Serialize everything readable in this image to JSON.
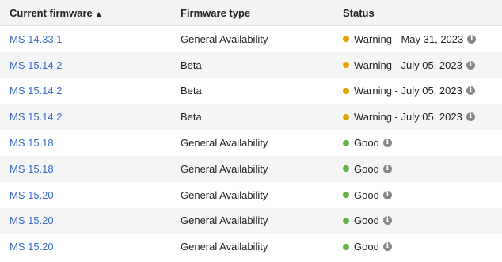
{
  "header": {
    "col_firmware": "Current firmware",
    "sort_arrow": "▲",
    "col_type": "Firmware type",
    "col_status": "Status"
  },
  "rows": [
    {
      "firmware": "MS 14.33.1",
      "type": "General Availability",
      "status": "Warning - May 31, 2023",
      "level": "warning"
    },
    {
      "firmware": "MS 15.14.2",
      "type": "Beta",
      "status": "Warning - July 05, 2023",
      "level": "warning"
    },
    {
      "firmware": "MS 15.14.2",
      "type": "Beta",
      "status": "Warning - July 05, 2023",
      "level": "warning"
    },
    {
      "firmware": "MS 15.14.2",
      "type": "Beta",
      "status": "Warning - July 05, 2023",
      "level": "warning"
    },
    {
      "firmware": "MS 15.18",
      "type": "General Availability",
      "status": "Good",
      "level": "good"
    },
    {
      "firmware": "MS 15.18",
      "type": "General Availability",
      "status": "Good",
      "level": "good"
    },
    {
      "firmware": "MS 15.20",
      "type": "General Availability",
      "status": "Good",
      "level": "good"
    },
    {
      "firmware": "MS 15.20",
      "type": "General Availability",
      "status": "Good",
      "level": "good"
    },
    {
      "firmware": "MS 15.20",
      "type": "General Availability",
      "status": "Good",
      "level": "good"
    }
  ],
  "icons": {
    "info": "info-icon",
    "status_dot": "status-dot-icon"
  },
  "colors": {
    "link": "#3b6cc4",
    "warning": "#e2a400",
    "good": "#67b14a"
  }
}
